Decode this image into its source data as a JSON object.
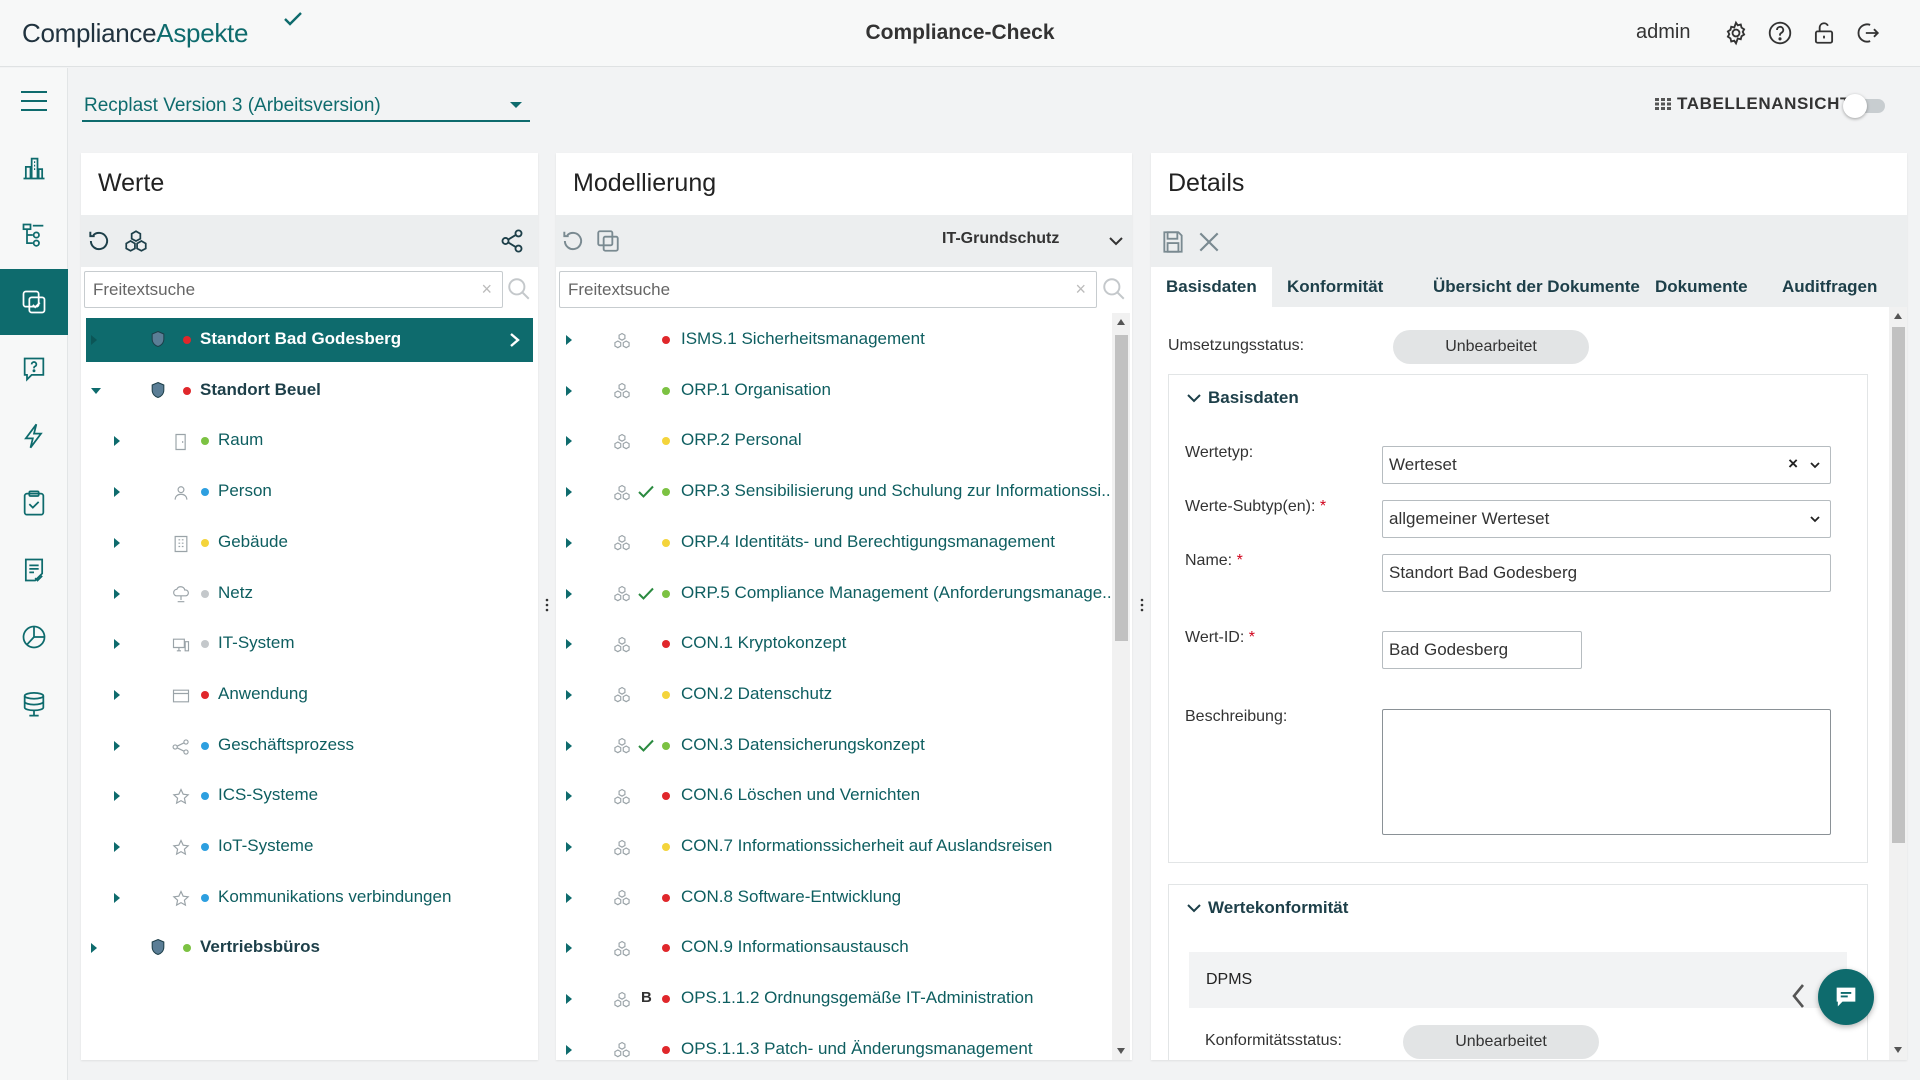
{
  "header": {
    "logo_part1": "Compliance",
    "logo_part2": "Aspekte",
    "title": "Compliance-Check",
    "user": "admin",
    "icons": [
      "settings-icon",
      "help-icon",
      "unlock-icon",
      "logout-icon"
    ]
  },
  "sidebar": {
    "items": [
      "menu-icon",
      "organization-icon",
      "tree-structure-icon",
      "modeling-icon",
      "questions-icon",
      "lightning-icon",
      "clipboard-check-icon",
      "report-icon",
      "chart-pie-icon",
      "database-icon"
    ],
    "active": "modeling-icon"
  },
  "version": {
    "selected": "Recplast Version 3 (Arbeitsversion)"
  },
  "table_view": {
    "label": "TABELLENANSICHT",
    "enabled": false
  },
  "werte": {
    "title": "Werte",
    "search_placeholder": "Freitextsuche",
    "items": [
      {
        "label": "Standort Bad Godesberg",
        "level": 0,
        "expanded": false,
        "active": true,
        "status": "red",
        "icon": "shield-icon",
        "bold": true
      },
      {
        "label": "Standort Beuel",
        "level": 0,
        "expanded": true,
        "active": false,
        "status": "red",
        "icon": "shield-icon",
        "bold": true
      },
      {
        "label": "Raum",
        "level": 1,
        "status": "green",
        "icon": "room-icon"
      },
      {
        "label": "Person",
        "level": 1,
        "status": "blue",
        "icon": "person-icon"
      },
      {
        "label": "Gebäude",
        "level": 1,
        "status": "yellow",
        "icon": "building-icon"
      },
      {
        "label": "Netz",
        "level": 1,
        "status": "grey",
        "icon": "network-icon"
      },
      {
        "label": "IT-System",
        "level": 1,
        "status": "grey",
        "icon": "it-system-icon"
      },
      {
        "label": "Anwendung",
        "level": 1,
        "status": "red",
        "icon": "application-icon"
      },
      {
        "label": "Geschäftsprozess",
        "level": 1,
        "status": "blue",
        "icon": "process-icon"
      },
      {
        "label": "ICS-Systeme",
        "level": 1,
        "status": "blue",
        "icon": "star-icon"
      },
      {
        "label": "IoT-Systeme",
        "level": 1,
        "status": "blue",
        "icon": "star-icon"
      },
      {
        "label": "Kommunikations verbindungen",
        "level": 1,
        "status": "blue",
        "icon": "star-icon"
      },
      {
        "label": "Vertriebsbüros",
        "level": 0,
        "expanded": false,
        "status": "green",
        "icon": "shield-icon",
        "bold": true
      }
    ]
  },
  "modellierung": {
    "title": "Modellierung",
    "filter": "IT-Grundschutz",
    "search_placeholder": "Freitextsuche",
    "items": [
      {
        "label": "ISMS.1 Sicherheitsmanagement",
        "status": "red",
        "check": false,
        "badge": ""
      },
      {
        "label": "ORP.1 Organisation",
        "status": "green",
        "check": false,
        "badge": ""
      },
      {
        "label": "ORP.2 Personal",
        "status": "yellow",
        "check": false,
        "badge": ""
      },
      {
        "label": "ORP.3 Sensibilisierung und Schulung zur Informationssi...",
        "status": "green",
        "check": true,
        "badge": ""
      },
      {
        "label": "ORP.4 Identitäts- und Berechtigungsmanagement",
        "status": "yellow",
        "check": false,
        "badge": ""
      },
      {
        "label": "ORP.5 Compliance Management (Anforderungsmanage...",
        "status": "green",
        "check": true,
        "badge": ""
      },
      {
        "label": "CON.1 Kryptokonzept",
        "status": "red",
        "check": false,
        "badge": ""
      },
      {
        "label": "CON.2 Datenschutz",
        "status": "yellow",
        "check": false,
        "badge": ""
      },
      {
        "label": "CON.3 Datensicherungskonzept",
        "status": "green",
        "check": true,
        "badge": ""
      },
      {
        "label": "CON.6 Löschen und Vernichten",
        "status": "red",
        "check": false,
        "badge": ""
      },
      {
        "label": "CON.7 Informationssicherheit auf Auslandsreisen",
        "status": "yellow",
        "check": false,
        "badge": ""
      },
      {
        "label": "CON.8 Software-Entwicklung",
        "status": "red",
        "check": false,
        "badge": ""
      },
      {
        "label": "CON.9 Informationsaustausch",
        "status": "red",
        "check": false,
        "badge": ""
      },
      {
        "label": "OPS.1.1.2 Ordnungsgemäße IT-Administration",
        "status": "red",
        "check": false,
        "badge": "B"
      },
      {
        "label": "OPS.1.1.3 Patch- und Änderungsmanagement",
        "status": "red",
        "check": false,
        "badge": ""
      }
    ]
  },
  "details": {
    "title": "Details",
    "tabs": [
      "Basisdaten",
      "Konformität",
      "Übersicht der Dokumente",
      "Dokumente",
      "Auditfragen"
    ],
    "active_tab": "Basisdaten",
    "umsetzungsstatus_label": "Umsetzungsstatus:",
    "umsetzungsstatus_value": "Unbearbeitet",
    "basisdaten_section": "Basisdaten",
    "wertetyp_label": "Wertetyp:",
    "wertetyp_value": "Werteset",
    "subtyp_label": "Werte-Subtyp(en):",
    "subtyp_value": "allgemeiner Werteset",
    "name_label": "Name:",
    "name_value": "Standort Bad Godesberg",
    "wertid_label": "Wert-ID:",
    "wertid_value": "Bad Godesberg",
    "beschreibung_label": "Beschreibung:",
    "beschreibung_value": "",
    "req_mark": "*",
    "wertekonformitaet_section": "Wertekonformität",
    "dpms_label": "DPMS",
    "konformitaet_label": "Konformitätsstatus:",
    "konformitaet_value": "Unbearbeitet"
  },
  "colors": {
    "primary": "#0e6b6d",
    "red": "#e0272b",
    "green": "#7cc242",
    "yellow": "#f4d43b",
    "blue": "#2d9fe0",
    "grey": "#c4c8cb"
  }
}
